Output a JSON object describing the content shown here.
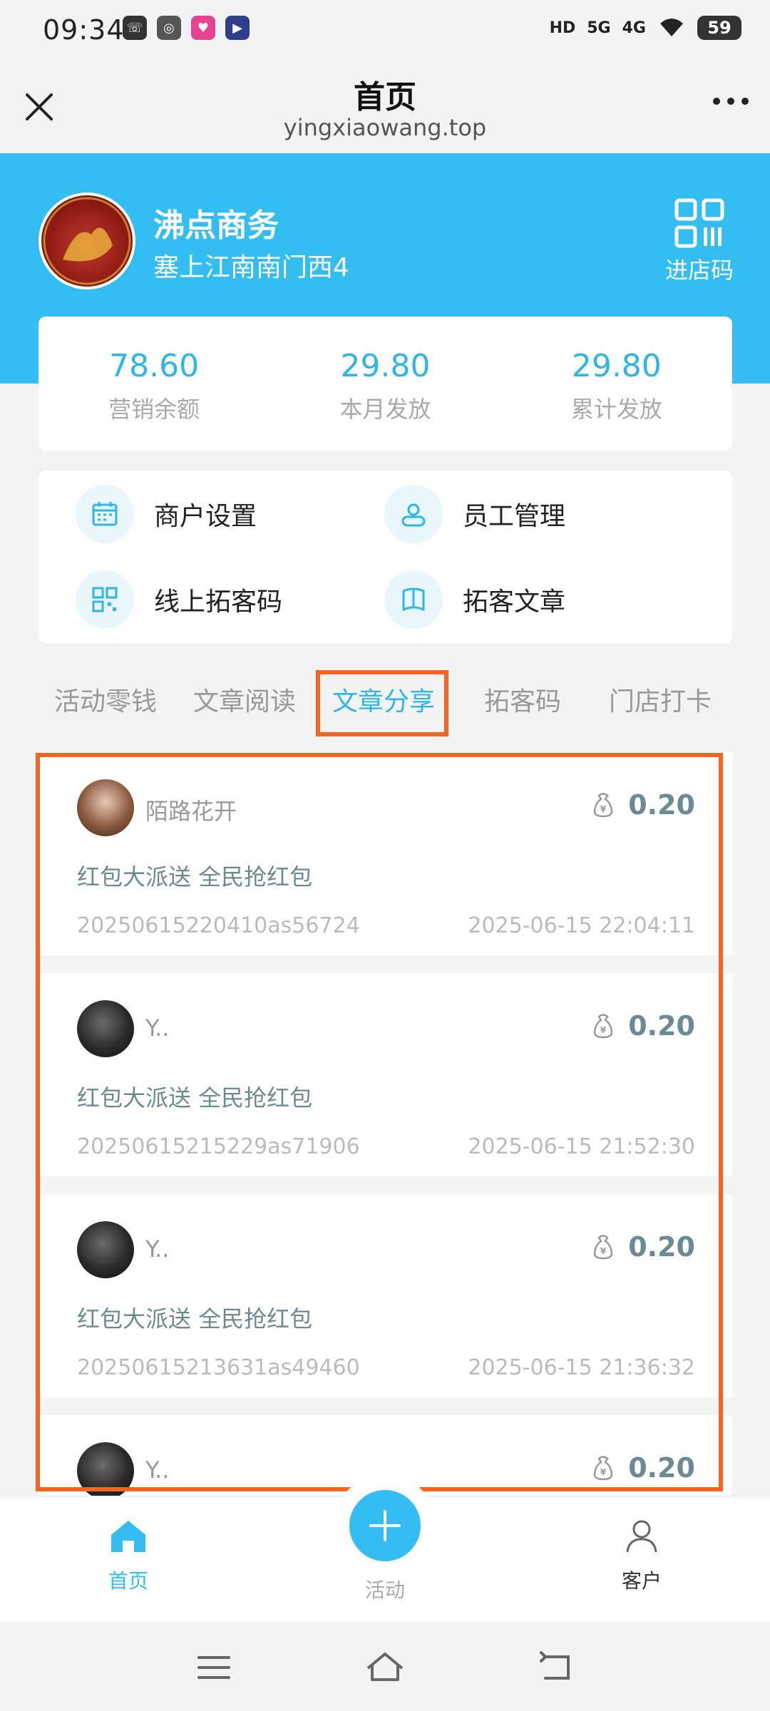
{
  "status_bar": {
    "time": "09:34",
    "battery": "59",
    "network": [
      "HD",
      "5G",
      "4G"
    ]
  },
  "title_bar": {
    "title": "首页",
    "url": "yingxiaowang.top"
  },
  "header": {
    "shop_name": "沸点商务",
    "shop_subtitle": "塞上江南南门西4",
    "qr_label": "进店码",
    "bg_color": "#34bdf0"
  },
  "stats": [
    {
      "value": "78.60",
      "label": "营销余额"
    },
    {
      "value": "29.80",
      "label": "本月发放"
    },
    {
      "value": "29.80",
      "label": "累计发放"
    }
  ],
  "quick_actions": [
    {
      "label": "商户设置",
      "icon": "calendar-icon"
    },
    {
      "label": "员工管理",
      "icon": "user-badge-icon"
    },
    {
      "label": "线上拓客码",
      "icon": "qr-code-icon"
    },
    {
      "label": "拓客文章",
      "icon": "book-icon"
    }
  ],
  "tabs": [
    {
      "label": "活动零钱",
      "active": false
    },
    {
      "label": "文章阅读",
      "active": false
    },
    {
      "label": "文章分享",
      "active": true
    },
    {
      "label": "拓客码",
      "active": false
    },
    {
      "label": "门店打卡",
      "active": false
    }
  ],
  "records": [
    {
      "user": "陌路花开",
      "amount": "0.20",
      "title": "红包大派送 全民抢红包",
      "id": "20250615220410as56724",
      "time": "2025-06-15 22:04:11"
    },
    {
      "user": "Y..",
      "amount": "0.20",
      "title": "红包大派送 全民抢红包",
      "id": "20250615215229as71906",
      "time": "2025-06-15 21:52:30"
    },
    {
      "user": "Y..",
      "amount": "0.20",
      "title": "红包大派送 全民抢红包",
      "id": "20250615213631as49460",
      "time": "2025-06-15 21:36:32"
    },
    {
      "user": "Y..",
      "amount": "0.20",
      "title": "",
      "id": "",
      "time": ""
    }
  ],
  "bottom_nav": {
    "home": "首页",
    "activity": "活动",
    "customer": "客户"
  },
  "colors": {
    "accent": "#34bdf0",
    "highlight_frame": "#f26522"
  }
}
